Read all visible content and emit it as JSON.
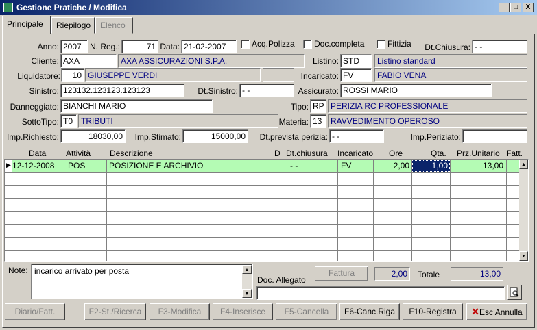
{
  "window": {
    "title": "Gestione Pratiche / Modifica",
    "min": "_",
    "max": "□",
    "close": "X"
  },
  "tabs": [
    {
      "label": "Principale",
      "state": "active"
    },
    {
      "label": "Riepilogo",
      "state": "normal"
    },
    {
      "label": "Elenco",
      "state": "disabled"
    }
  ],
  "form": {
    "anno_label": "Anno:",
    "anno": "2007",
    "nreg_label": "N. Reg.:",
    "nreg": "71",
    "data_label": "Data:",
    "data": "21-02-2007",
    "acq_polizza": "Acq.Polizza",
    "doc_completa": "Doc.completa",
    "fittizia": "Fittizia",
    "dt_chiusura_label": "Dt.Chiusura:",
    "dt_chiusura": "- -",
    "cliente_label": "Cliente:",
    "cliente_code": "AXA",
    "cliente_name": "AXA ASSICURAZIONI S.P.A.",
    "listino_label": "Listino:",
    "listino_code": "STD",
    "listino_name": "Listino standard",
    "liquidatore_label": "Liquidatore:",
    "liquidatore_code": "10",
    "liquidatore_name": "GIUSEPPE VERDI",
    "incaricato_label": "Incaricato:",
    "incaricato_code": "FV",
    "incaricato_name": "FABIO VENA",
    "sinistro_label": "Sinistro:",
    "sinistro": "123132.123123.123123",
    "dt_sinistro_label": "Dt.Sinistro:",
    "dt_sinistro": "- -",
    "assicurato_label": "Assicurato:",
    "assicurato": "ROSSI MARIO",
    "danneggiato_label": "Danneggiato:",
    "danneggiato": "BIANCHI MARIO",
    "tipo_label": "Tipo:",
    "tipo_code": "RP",
    "tipo_name": "PERIZIA RC PROFESSIONALE",
    "sottotipo_label": "SottoTipo:",
    "sottotipo_code": "T0",
    "sottotipo_name": "TRIBUTI",
    "materia_label": "Materia:",
    "materia_code": "13",
    "materia_name": "RAVVEDIMENTO OPEROSO",
    "imp_richiesto_label": "Imp.Richiesto:",
    "imp_richiesto": "18030,00",
    "imp_stimato_label": "Imp.Stimato:",
    "imp_stimato": "15000,00",
    "dt_prevista_label": "Dt.prevista perizia:",
    "dt_prevista": "- -",
    "imp_periziato_label": "Imp.Periziato:",
    "imp_periziato": ""
  },
  "grid": {
    "columns": [
      "Data",
      "Attività",
      "Descrizione",
      "D",
      "Dt.chiusura",
      "Incaricato",
      "Ore",
      "Qta.",
      "Prz.Unitario",
      "Fatt."
    ],
    "rows": [
      {
        "data": "12-12-2008",
        "attivita": "POS",
        "descrizione": "POSIZIONE E ARCHIVIO",
        "d": "",
        "dt_chiusura": "- -",
        "incaricato": "FV",
        "ore": "2,00",
        "qta": "1,00",
        "prz": "13,00",
        "fatt": ""
      }
    ]
  },
  "bottom": {
    "note_label": "Note:",
    "note": "incarico arrivato per posta",
    "doc_allegato_label": "Doc. Allegato",
    "doc_allegato": "",
    "fattura": "Fattura",
    "ore_totale": "2,00",
    "totale_label": "Totale",
    "totale": "13,00"
  },
  "buttons": {
    "diario": "Diario/Fatt.",
    "f2": "F2-St./Ricerca",
    "f3": "F3-Modifica",
    "f4": "F4-Inserisce",
    "f5": "F5-Cancella",
    "f6": "F6-Canc.Riga",
    "f10": "F10-Registra",
    "esc_prefix": "Esc",
    "esc_label": "Annulla"
  }
}
